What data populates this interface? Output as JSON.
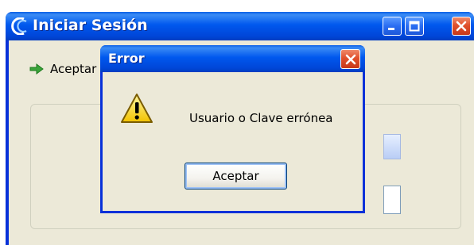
{
  "main_window": {
    "title": "Iniciar Sesión",
    "toolbar": {
      "accept_label": "Aceptar"
    },
    "controls": {
      "minimize_icon": "minimize-icon",
      "maximize_icon": "maximize-icon",
      "close_icon": "close-icon"
    }
  },
  "dialog": {
    "title": "Error",
    "message": "Usuario o Clave errónea",
    "ok_label": "Aceptar",
    "icon": "warning-icon"
  },
  "colors": {
    "titlebar_blue": "#0058ee",
    "close_red": "#e0502c",
    "window_face": "#ece9d8",
    "accept_arrow": "#3aa43a"
  }
}
